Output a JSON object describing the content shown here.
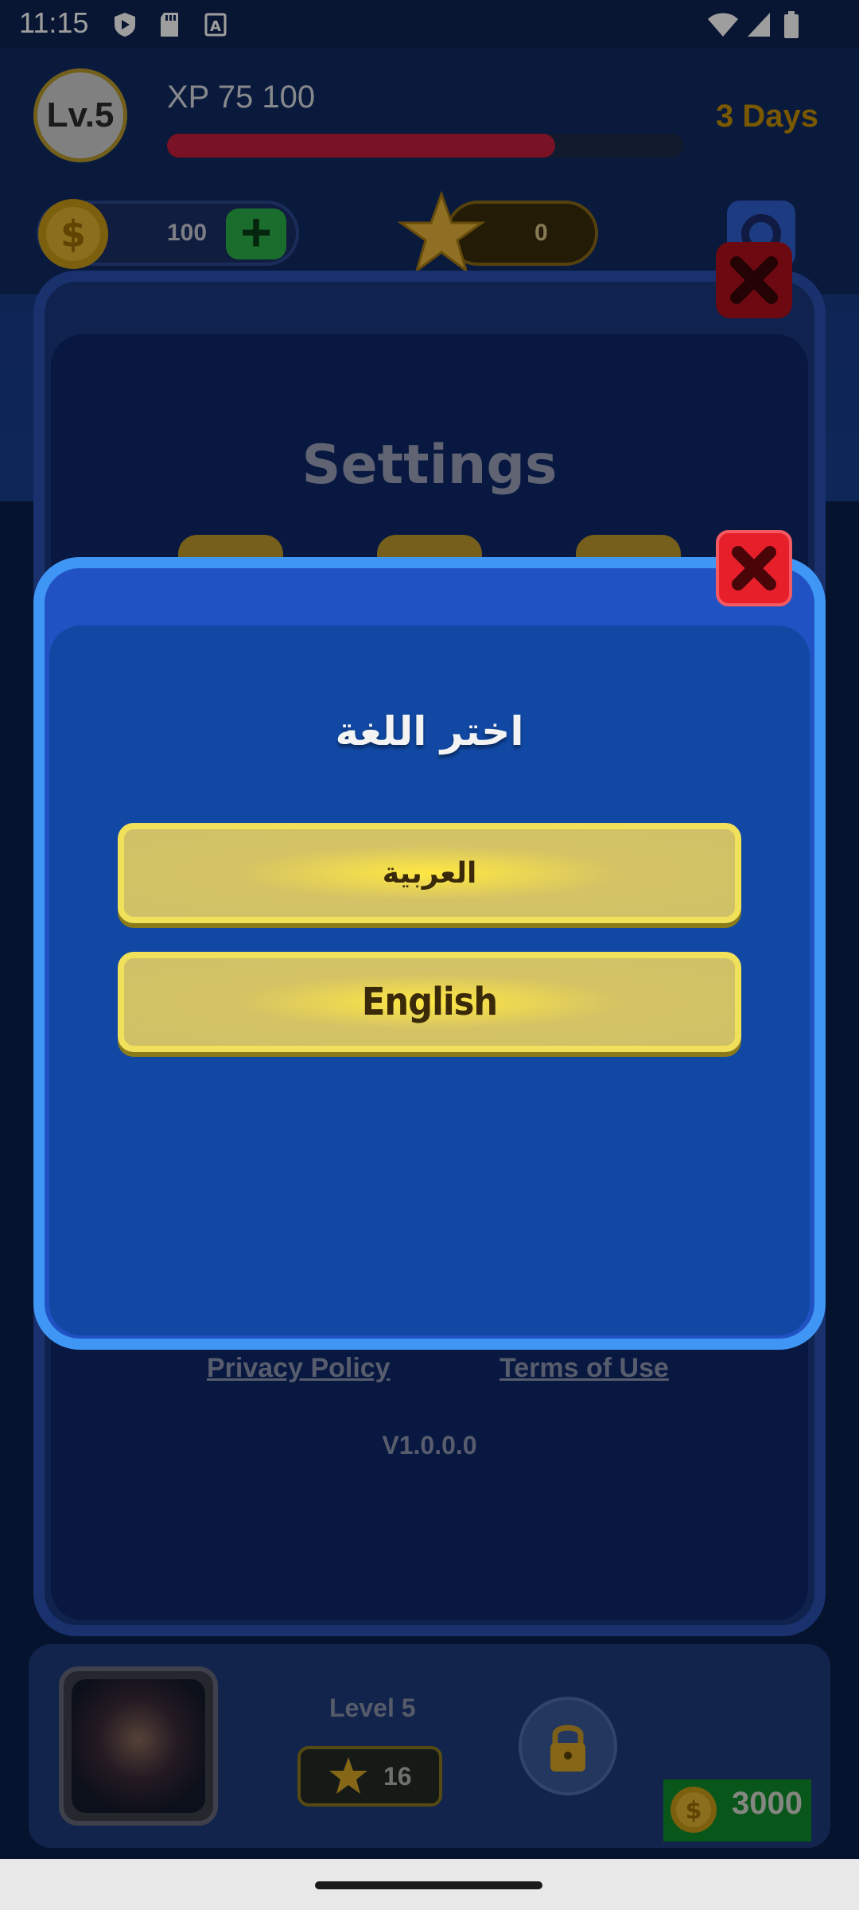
{
  "status_bar": {
    "time": "11:15",
    "icons": [
      "play-shield-icon",
      "sd-card-icon",
      "a-box-icon",
      "wifi-icon",
      "signal-icon",
      "battery-icon"
    ]
  },
  "header": {
    "level_badge": "Lv.5",
    "xp_text": "XP 75 100",
    "xp_progress": 0.75,
    "timer": "3 Days"
  },
  "currency": {
    "coins": "100",
    "stars": "0"
  },
  "settings_panel": {
    "title": "Settings",
    "privacy_link": "Privacy Policy",
    "terms_link": "Terms of Use",
    "version": "V1.0.0.0"
  },
  "language_dialog": {
    "title": "اختر اللغة",
    "options": [
      "العربية",
      "English"
    ]
  },
  "level_card": {
    "label": "Level 5",
    "stars": "16",
    "price": "3000"
  },
  "colors": {
    "dialog_bg": "#1048a3",
    "dialog_border": "#3f96f4",
    "button_gold": "#f1e05a",
    "close_red": "#e61f2b"
  }
}
